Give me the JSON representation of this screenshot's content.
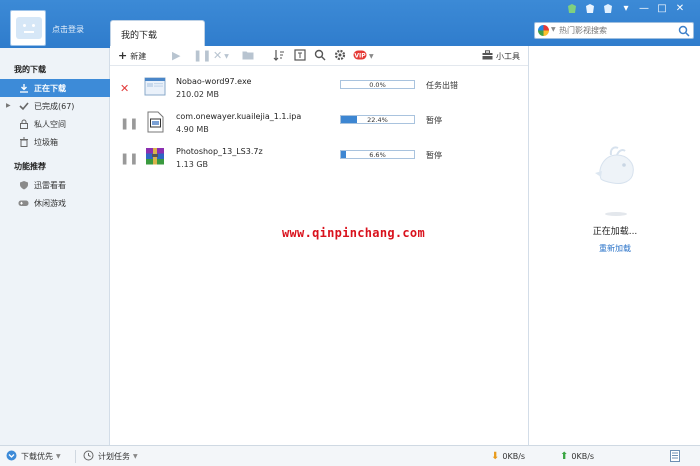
{
  "header": {
    "login_label": "点击登录",
    "active_tab": "我的下载",
    "search_placeholder": "热门影视搜索"
  },
  "sidebar": {
    "section_downloads": "我的下载",
    "items": [
      {
        "label": "正在下载",
        "icon": "download-icon",
        "active": true
      },
      {
        "label": "已完成(67)",
        "icon": "check-icon",
        "active": false
      },
      {
        "label": "私人空间",
        "icon": "lock-icon",
        "active": false
      },
      {
        "label": "垃圾箱",
        "icon": "trash-icon",
        "active": false
      }
    ],
    "section_features": "功能推荐",
    "features": [
      {
        "label": "迅雷看看",
        "icon": "shield-icon"
      },
      {
        "label": "休闲游戏",
        "icon": "gamepad-icon"
      }
    ]
  },
  "toolbar": {
    "new_label": "新建",
    "tools_label": "小工具"
  },
  "downloads": [
    {
      "name": "Nobao-word97.exe",
      "size": "210.02 MB",
      "progress": 0.0,
      "progress_text": "0.0%",
      "status": "任务出错",
      "control": "error-x"
    },
    {
      "name": "com.onewayer.kuailejia_1.1.ipa",
      "size": "4.90 MB",
      "progress": 22.4,
      "progress_text": "22.4%",
      "status": "暂停",
      "control": "pause"
    },
    {
      "name": "Photoshop_13_LS3.7z",
      "size": "1.13 GB",
      "progress": 6.6,
      "progress_text": "6.6%",
      "status": "暂停",
      "control": "pause"
    }
  ],
  "watermark": "www.qinpinchang.com",
  "right_panel": {
    "loading_text": "正在加载...",
    "reload_link": "重新加载"
  },
  "statusbar": {
    "priority_label": "下载优先",
    "schedule_label": "计划任务",
    "download_speed": "0KB/s",
    "upload_speed": "0KB/s"
  },
  "colors": {
    "accent": "#3d8bd8",
    "error": "#e23b3b",
    "watermark": "#d9121d"
  }
}
